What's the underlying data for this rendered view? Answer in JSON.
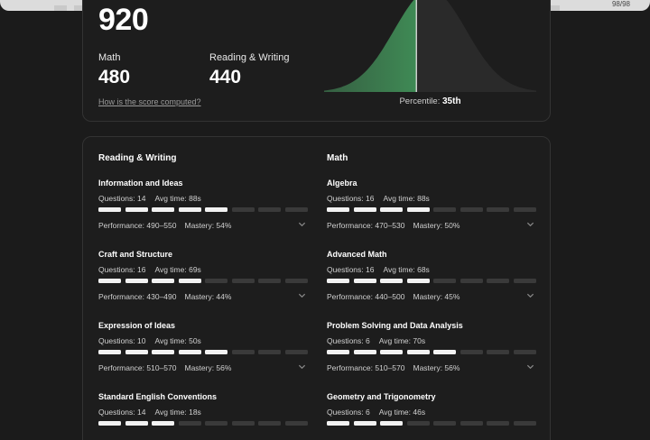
{
  "topbar": {
    "counter": "98/98"
  },
  "score": {
    "total": "920",
    "math_label": "Math",
    "math_value": "480",
    "rw_label": "Reading & Writing",
    "rw_value": "440",
    "how_link": "How is the score computed?",
    "percentile_label": "Percentile:",
    "percentile_value": "35th",
    "percentile_fraction": 0.35,
    "colors": {
      "fill": "#3f8a55",
      "curve": "#2a2a2a"
    }
  },
  "breakdown": {
    "left_title": "Reading & Writing",
    "right_title": "Math",
    "left": [
      {
        "name": "Information and Ideas",
        "questions": "Questions: 14",
        "avg": "Avg time: 88s",
        "filled": 5,
        "perf": "Performance: 490–550",
        "mastery": "Mastery: 54%"
      },
      {
        "name": "Craft and Structure",
        "questions": "Questions: 16",
        "avg": "Avg time: 69s",
        "filled": 4,
        "perf": "Performance: 430–490",
        "mastery": "Mastery: 44%"
      },
      {
        "name": "Expression of Ideas",
        "questions": "Questions: 10",
        "avg": "Avg time: 50s",
        "filled": 5,
        "perf": "Performance: 510–570",
        "mastery": "Mastery: 56%"
      },
      {
        "name": "Standard English Conventions",
        "questions": "Questions: 14",
        "avg": "Avg time: 18s",
        "filled": 3,
        "perf": "",
        "mastery": ""
      }
    ],
    "right": [
      {
        "name": "Algebra",
        "questions": "Questions: 16",
        "avg": "Avg time: 88s",
        "filled": 4,
        "perf": "Performance: 470–530",
        "mastery": "Mastery: 50%"
      },
      {
        "name": "Advanced Math",
        "questions": "Questions: 16",
        "avg": "Avg time: 68s",
        "filled": 4,
        "perf": "Performance: 440–500",
        "mastery": "Mastery: 45%"
      },
      {
        "name": "Problem Solving and Data Analysis",
        "questions": "Questions: 6",
        "avg": "Avg time: 70s",
        "filled": 5,
        "perf": "Performance: 510–570",
        "mastery": "Mastery: 56%"
      },
      {
        "name": "Geometry and Trigonometry",
        "questions": "Questions: 6",
        "avg": "Avg time: 46s",
        "filled": 3,
        "perf": "",
        "mastery": ""
      }
    ],
    "segments_total": 8
  }
}
